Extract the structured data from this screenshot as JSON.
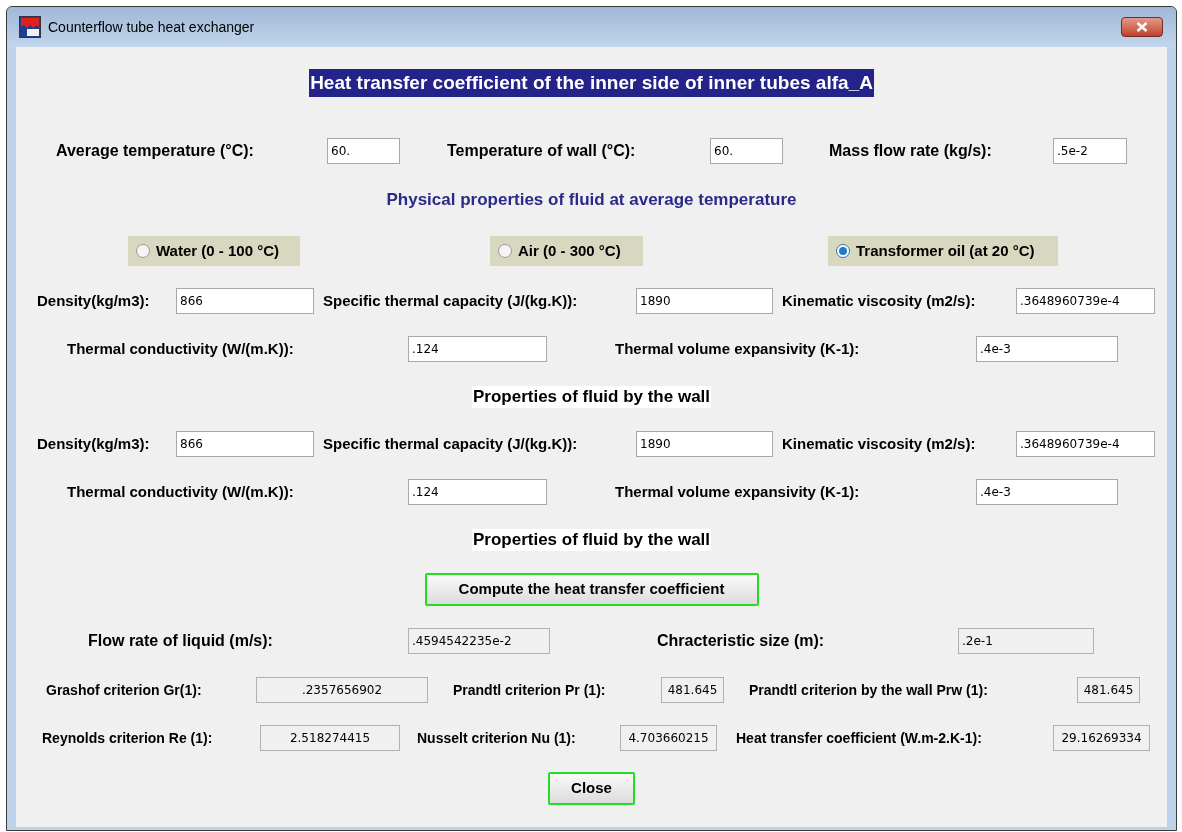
{
  "window": {
    "title": "Counterflow tube heat exchanger"
  },
  "heading": "Heat transfer coefficient of the inner side of inner tubes alfa_A",
  "inputs": [
    {
      "label": "Average temperature (°C):",
      "value": "60."
    },
    {
      "label": "Temperature of wall (°C):",
      "value": "60."
    },
    {
      "label": "Mass flow rate (kg/s):",
      "value": ".5e-2"
    }
  ],
  "properties_heading": "Physical properties of fluid at average temperature",
  "fluids": [
    {
      "label": "Water (0 - 100 °C)",
      "selected": false
    },
    {
      "label": "Air (0 - 300 °C)",
      "selected": false
    },
    {
      "label": "Transformer oil (at 20 °C)",
      "selected": true
    }
  ],
  "average_properties": [
    [
      {
        "label": "Density(kg/m3):",
        "value": "866"
      },
      {
        "label": "Specific thermal capacity (J/(kg.K)):",
        "value": "1890"
      },
      {
        "label": "Kinematic viscosity (m2/s):",
        "value": ".3648960739e-4"
      }
    ],
    [
      {
        "label": "Thermal conductivity (W/(m.K)):",
        "value": ".124"
      },
      {
        "label": "Thermal volume expansivity (K-1):",
        "value": ".4e-3"
      }
    ]
  ],
  "wall_heading": "Properties of fluid by the wall",
  "wall_properties": [
    [
      {
        "label": "Density(kg/m3):",
        "value": "866"
      },
      {
        "label": "Specific thermal capacity (J/(kg.K)):",
        "value": "1890"
      },
      {
        "label": "Kinematic viscosity (m2/s):",
        "value": ".3648960739e-4"
      }
    ],
    [
      {
        "label": "Thermal conductivity (W/(m.K)):",
        "value": ".124"
      },
      {
        "label": "Thermal volume expansivity (K-1):",
        "value": ".4e-3"
      }
    ]
  ],
  "results_heading": "Properties of fluid by the wall",
  "compute_button": "Compute the heat transfer coefficient",
  "results": [
    [
      {
        "label": "Flow rate of liquid (m/s):",
        "value": ".4594542235e-2"
      },
      {
        "label": "Chracteristic size (m):",
        "value": ".2e-1"
      }
    ],
    [
      {
        "label": "Grashof criterion Gr(1):",
        "value": ".2357656902"
      },
      {
        "label": "Prandtl criterion Pr (1):",
        "value": "481.645"
      },
      {
        "label": "Prandtl criterion by the wall Prw    (1):",
        "value": "481.645"
      }
    ],
    [
      {
        "label": "Reynolds criterion Re (1):",
        "value": "2.518274415"
      },
      {
        "label": "Nusselt criterion Nu (1):",
        "value": "4.703660215"
      },
      {
        "label": "Heat transfer coefficient (W.m-2.K-1):",
        "value": "29.16269334"
      }
    ]
  ],
  "close_button": "Close"
}
